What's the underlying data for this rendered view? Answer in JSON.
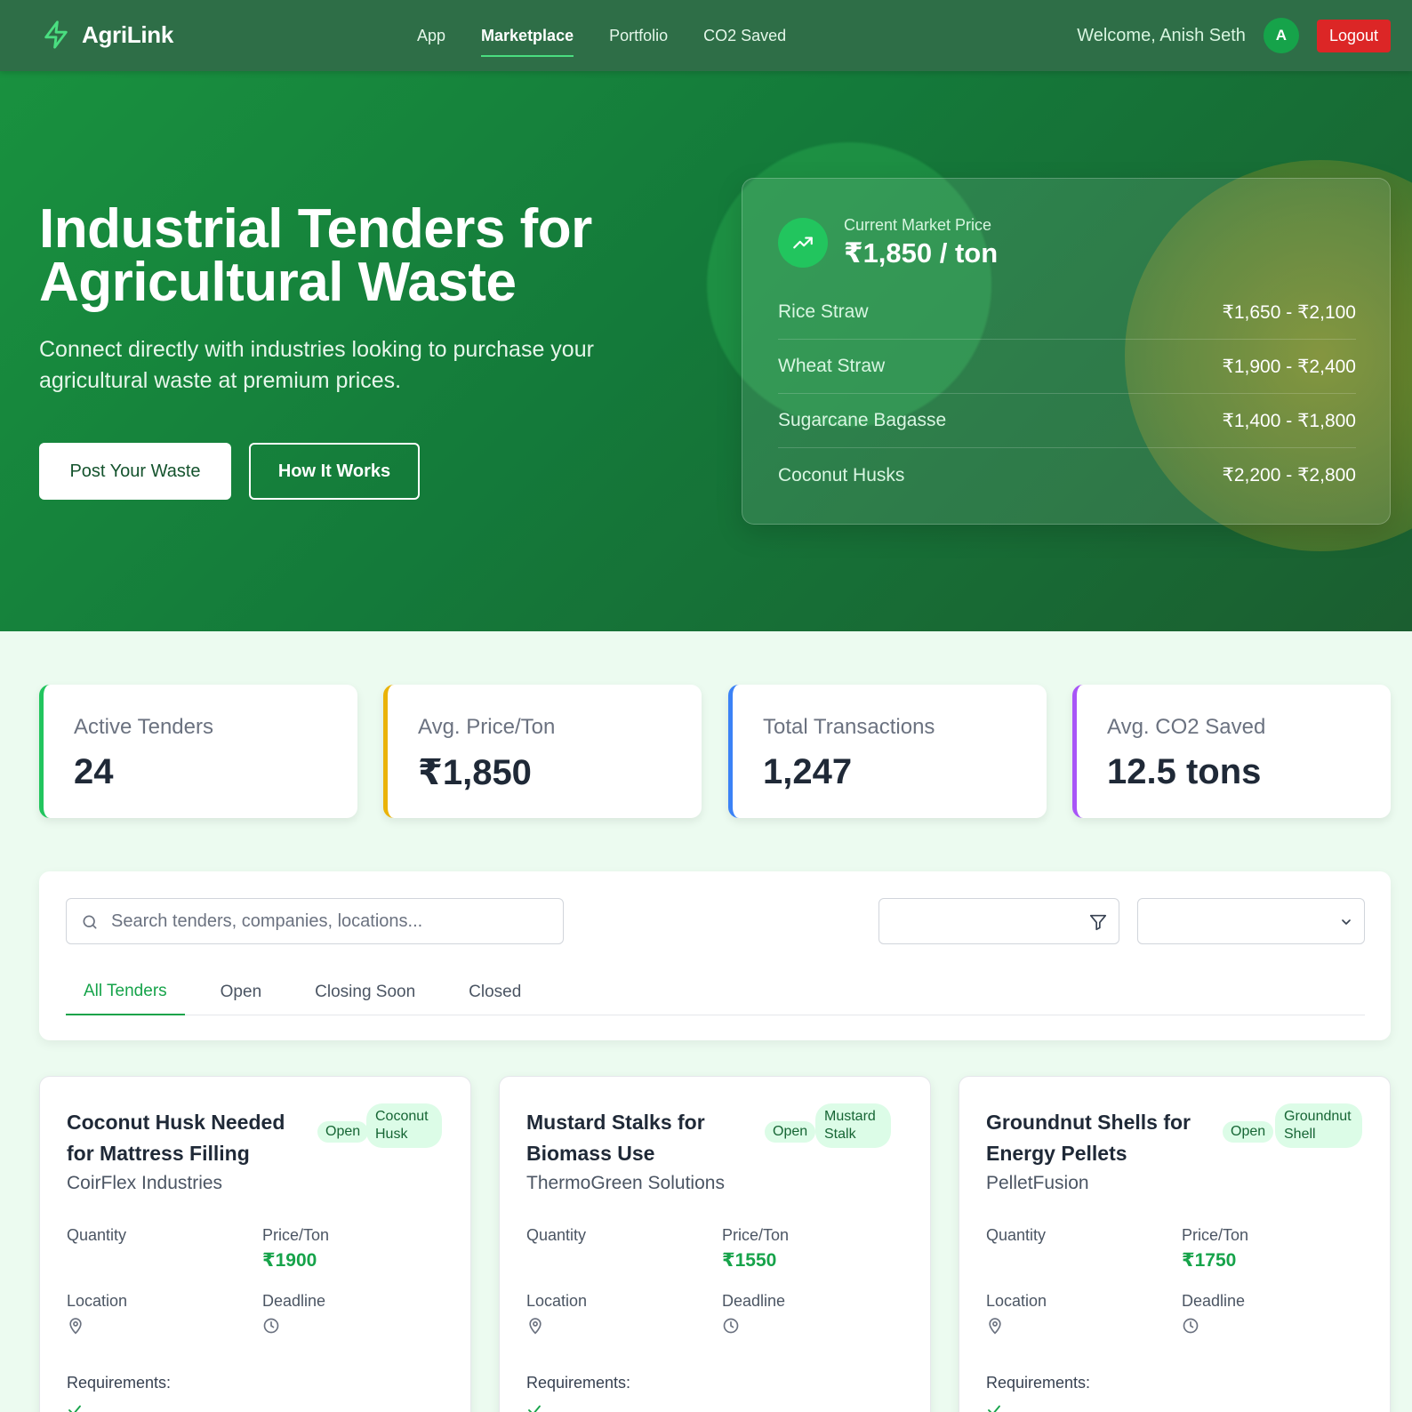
{
  "nav": {
    "brand": "AgriLink",
    "links": [
      "App",
      "Marketplace",
      "Portfolio",
      "CO2 Saved"
    ],
    "active": "Marketplace",
    "welcome": "Welcome, Anish Seth",
    "avatar_initial": "A",
    "logout": "Logout"
  },
  "hero": {
    "title": "Industrial Tenders for Agricultural Waste",
    "subtitle": "Connect directly with industries looking to purchase your agricultural waste at premium prices.",
    "primary_button": "Post Your Waste",
    "secondary_button": "How It Works",
    "market": {
      "label": "Current Market Price",
      "value": "₹1,850 / ton",
      "rows": [
        {
          "name": "Rice Straw",
          "range": "₹1,650 - ₹2,100"
        },
        {
          "name": "Wheat Straw",
          "range": "₹1,900 - ₹2,400"
        },
        {
          "name": "Sugarcane Bagasse",
          "range": "₹1,400 - ₹1,800"
        },
        {
          "name": "Coconut Husks",
          "range": "₹2,200 - ₹2,800"
        }
      ]
    }
  },
  "stats": [
    {
      "label": "Active Tenders",
      "value": "24",
      "color": "#22c55e"
    },
    {
      "label": "Avg. Price/Ton",
      "value": "₹1,850",
      "color": "#eab308"
    },
    {
      "label": "Total Transactions",
      "value": "1,247",
      "color": "#3b82f6"
    },
    {
      "label": "Avg. CO2 Saved",
      "value": "12.5 tons",
      "color": "#a855f7"
    }
  ],
  "filters": {
    "search_placeholder": "Search tenders, companies, locations...",
    "tabs": [
      "All Tenders",
      "Open",
      "Closing Soon",
      "Closed"
    ],
    "active_tab": "All Tenders"
  },
  "labels": {
    "quantity": "Quantity",
    "price": "Price/Ton",
    "location": "Location",
    "deadline": "Deadline",
    "requirements": "Requirements:"
  },
  "tenders": [
    {
      "title": "Coconut Husk Needed for Mattress Filling",
      "status": "Open",
      "type": "Coconut Husk",
      "company": "CoirFlex Industries",
      "price": "₹1900"
    },
    {
      "title": "Mustard Stalks for Biomass Use",
      "status": "Open",
      "type": "Mustard Stalk",
      "company": "ThermoGreen Solutions",
      "price": "₹1550"
    },
    {
      "title": "Groundnut Shells for Energy Pellets",
      "status": "Open",
      "type": "Groundnut Shell",
      "company": "PelletFusion",
      "price": "₹1750"
    }
  ]
}
